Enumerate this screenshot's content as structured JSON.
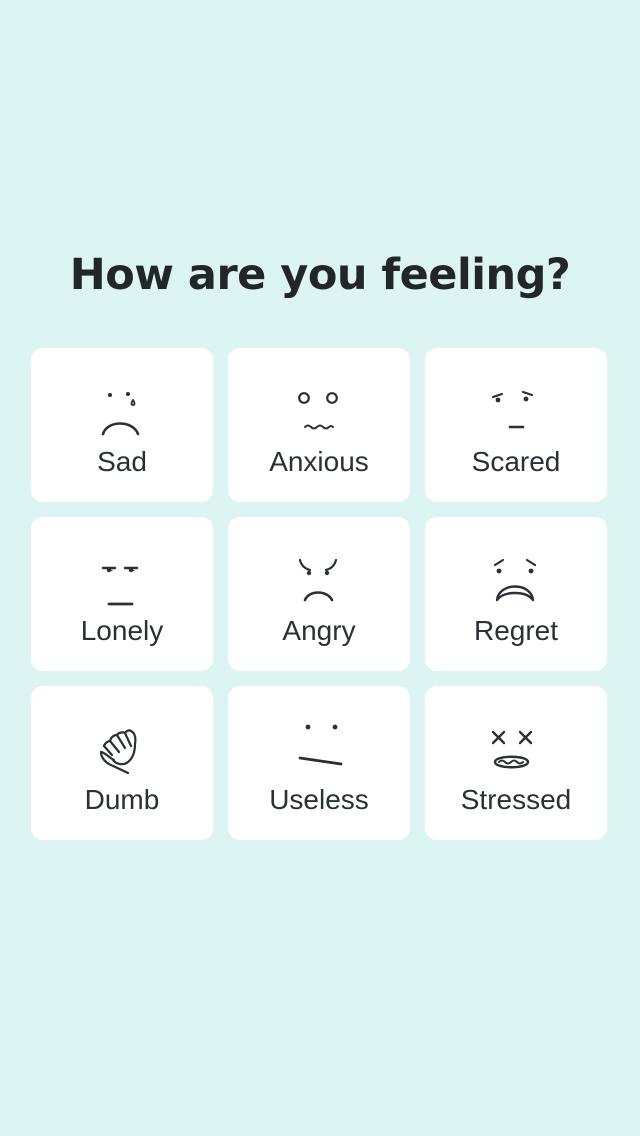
{
  "page": {
    "title": "How are you feeling?"
  },
  "colors": {
    "background": "#dcf5f2",
    "card": "#ffffff",
    "text": "#222629"
  },
  "feelings": [
    {
      "label": "Sad",
      "icon": "sad-face-icon"
    },
    {
      "label": "Anxious",
      "icon": "anxious-face-icon"
    },
    {
      "label": "Scared",
      "icon": "scared-face-icon"
    },
    {
      "label": "Lonely",
      "icon": "lonely-face-icon"
    },
    {
      "label": "Angry",
      "icon": "angry-face-icon"
    },
    {
      "label": "Regret",
      "icon": "regret-face-icon"
    },
    {
      "label": "Dumb",
      "icon": "facepalm-hand-icon"
    },
    {
      "label": "Useless",
      "icon": "useless-face-icon"
    },
    {
      "label": "Stressed",
      "icon": "stressed-face-icon"
    }
  ]
}
